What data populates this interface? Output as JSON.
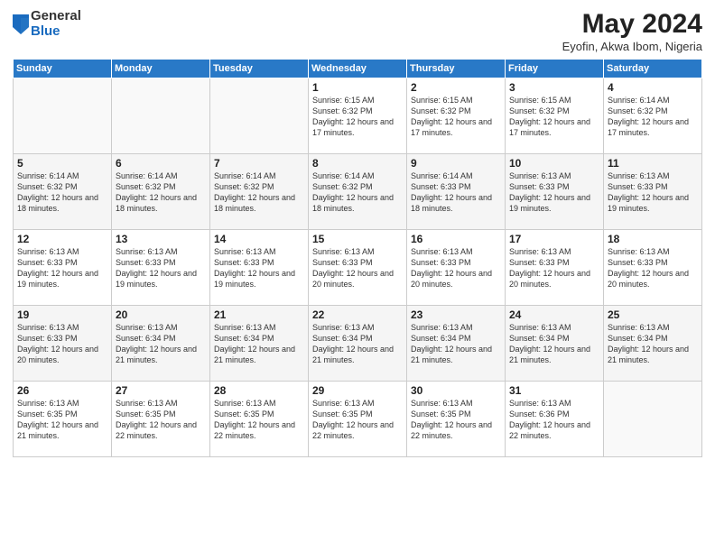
{
  "logo": {
    "general": "General",
    "blue": "Blue"
  },
  "header": {
    "month": "May 2024",
    "location": "Eyofin, Akwa Ibom, Nigeria"
  },
  "weekdays": [
    "Sunday",
    "Monday",
    "Tuesday",
    "Wednesday",
    "Thursday",
    "Friday",
    "Saturday"
  ],
  "weeks": [
    [
      {
        "day": "",
        "sunrise": "",
        "sunset": "",
        "daylight": ""
      },
      {
        "day": "",
        "sunrise": "",
        "sunset": "",
        "daylight": ""
      },
      {
        "day": "",
        "sunrise": "",
        "sunset": "",
        "daylight": ""
      },
      {
        "day": "1",
        "sunrise": "Sunrise: 6:15 AM",
        "sunset": "Sunset: 6:32 PM",
        "daylight": "Daylight: 12 hours and 17 minutes."
      },
      {
        "day": "2",
        "sunrise": "Sunrise: 6:15 AM",
        "sunset": "Sunset: 6:32 PM",
        "daylight": "Daylight: 12 hours and 17 minutes."
      },
      {
        "day": "3",
        "sunrise": "Sunrise: 6:15 AM",
        "sunset": "Sunset: 6:32 PM",
        "daylight": "Daylight: 12 hours and 17 minutes."
      },
      {
        "day": "4",
        "sunrise": "Sunrise: 6:14 AM",
        "sunset": "Sunset: 6:32 PM",
        "daylight": "Daylight: 12 hours and 17 minutes."
      }
    ],
    [
      {
        "day": "5",
        "sunrise": "Sunrise: 6:14 AM",
        "sunset": "Sunset: 6:32 PM",
        "daylight": "Daylight: 12 hours and 18 minutes."
      },
      {
        "day": "6",
        "sunrise": "Sunrise: 6:14 AM",
        "sunset": "Sunset: 6:32 PM",
        "daylight": "Daylight: 12 hours and 18 minutes."
      },
      {
        "day": "7",
        "sunrise": "Sunrise: 6:14 AM",
        "sunset": "Sunset: 6:32 PM",
        "daylight": "Daylight: 12 hours and 18 minutes."
      },
      {
        "day": "8",
        "sunrise": "Sunrise: 6:14 AM",
        "sunset": "Sunset: 6:32 PM",
        "daylight": "Daylight: 12 hours and 18 minutes."
      },
      {
        "day": "9",
        "sunrise": "Sunrise: 6:14 AM",
        "sunset": "Sunset: 6:33 PM",
        "daylight": "Daylight: 12 hours and 18 minutes."
      },
      {
        "day": "10",
        "sunrise": "Sunrise: 6:13 AM",
        "sunset": "Sunset: 6:33 PM",
        "daylight": "Daylight: 12 hours and 19 minutes."
      },
      {
        "day": "11",
        "sunrise": "Sunrise: 6:13 AM",
        "sunset": "Sunset: 6:33 PM",
        "daylight": "Daylight: 12 hours and 19 minutes."
      }
    ],
    [
      {
        "day": "12",
        "sunrise": "Sunrise: 6:13 AM",
        "sunset": "Sunset: 6:33 PM",
        "daylight": "Daylight: 12 hours and 19 minutes."
      },
      {
        "day": "13",
        "sunrise": "Sunrise: 6:13 AM",
        "sunset": "Sunset: 6:33 PM",
        "daylight": "Daylight: 12 hours and 19 minutes."
      },
      {
        "day": "14",
        "sunrise": "Sunrise: 6:13 AM",
        "sunset": "Sunset: 6:33 PM",
        "daylight": "Daylight: 12 hours and 19 minutes."
      },
      {
        "day": "15",
        "sunrise": "Sunrise: 6:13 AM",
        "sunset": "Sunset: 6:33 PM",
        "daylight": "Daylight: 12 hours and 20 minutes."
      },
      {
        "day": "16",
        "sunrise": "Sunrise: 6:13 AM",
        "sunset": "Sunset: 6:33 PM",
        "daylight": "Daylight: 12 hours and 20 minutes."
      },
      {
        "day": "17",
        "sunrise": "Sunrise: 6:13 AM",
        "sunset": "Sunset: 6:33 PM",
        "daylight": "Daylight: 12 hours and 20 minutes."
      },
      {
        "day": "18",
        "sunrise": "Sunrise: 6:13 AM",
        "sunset": "Sunset: 6:33 PM",
        "daylight": "Daylight: 12 hours and 20 minutes."
      }
    ],
    [
      {
        "day": "19",
        "sunrise": "Sunrise: 6:13 AM",
        "sunset": "Sunset: 6:33 PM",
        "daylight": "Daylight: 12 hours and 20 minutes."
      },
      {
        "day": "20",
        "sunrise": "Sunrise: 6:13 AM",
        "sunset": "Sunset: 6:34 PM",
        "daylight": "Daylight: 12 hours and 21 minutes."
      },
      {
        "day": "21",
        "sunrise": "Sunrise: 6:13 AM",
        "sunset": "Sunset: 6:34 PM",
        "daylight": "Daylight: 12 hours and 21 minutes."
      },
      {
        "day": "22",
        "sunrise": "Sunrise: 6:13 AM",
        "sunset": "Sunset: 6:34 PM",
        "daylight": "Daylight: 12 hours and 21 minutes."
      },
      {
        "day": "23",
        "sunrise": "Sunrise: 6:13 AM",
        "sunset": "Sunset: 6:34 PM",
        "daylight": "Daylight: 12 hours and 21 minutes."
      },
      {
        "day": "24",
        "sunrise": "Sunrise: 6:13 AM",
        "sunset": "Sunset: 6:34 PM",
        "daylight": "Daylight: 12 hours and 21 minutes."
      },
      {
        "day": "25",
        "sunrise": "Sunrise: 6:13 AM",
        "sunset": "Sunset: 6:34 PM",
        "daylight": "Daylight: 12 hours and 21 minutes."
      }
    ],
    [
      {
        "day": "26",
        "sunrise": "Sunrise: 6:13 AM",
        "sunset": "Sunset: 6:35 PM",
        "daylight": "Daylight: 12 hours and 21 minutes."
      },
      {
        "day": "27",
        "sunrise": "Sunrise: 6:13 AM",
        "sunset": "Sunset: 6:35 PM",
        "daylight": "Daylight: 12 hours and 22 minutes."
      },
      {
        "day": "28",
        "sunrise": "Sunrise: 6:13 AM",
        "sunset": "Sunset: 6:35 PM",
        "daylight": "Daylight: 12 hours and 22 minutes."
      },
      {
        "day": "29",
        "sunrise": "Sunrise: 6:13 AM",
        "sunset": "Sunset: 6:35 PM",
        "daylight": "Daylight: 12 hours and 22 minutes."
      },
      {
        "day": "30",
        "sunrise": "Sunrise: 6:13 AM",
        "sunset": "Sunset: 6:35 PM",
        "daylight": "Daylight: 12 hours and 22 minutes."
      },
      {
        "day": "31",
        "sunrise": "Sunrise: 6:13 AM",
        "sunset": "Sunset: 6:36 PM",
        "daylight": "Daylight: 12 hours and 22 minutes."
      },
      {
        "day": "",
        "sunrise": "",
        "sunset": "",
        "daylight": ""
      }
    ]
  ]
}
